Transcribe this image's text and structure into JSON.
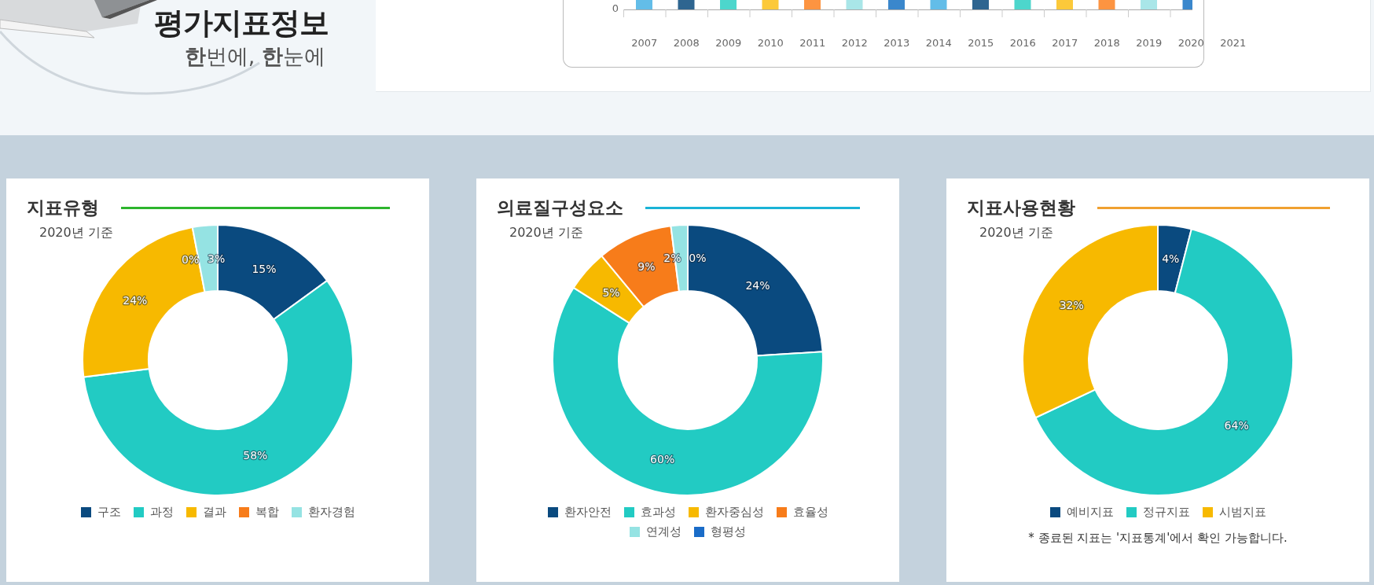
{
  "logo": {
    "title": "평가지표정보",
    "slogan": "**한**번에, **한**눈에"
  },
  "trend_chart": {
    "zero_label": "0",
    "years": [
      "2007",
      "2008",
      "2009",
      "2010",
      "2011",
      "2012",
      "2013",
      "2014",
      "2015",
      "2016",
      "2017",
      "2018",
      "2019",
      "2020",
      "2021"
    ]
  },
  "cards": [
    {
      "title": "지표유형",
      "color": "#2db52d",
      "subtitle": "2020년 기준",
      "chart_data": {
        "type": "donut",
        "categories": [
          "구조",
          "과정",
          "결과",
          "복합",
          "환자경험"
        ],
        "values": [
          15,
          58,
          24,
          0,
          3
        ],
        "value_labels": [
          "15%",
          "58%",
          "24%",
          "0%",
          "3%"
        ]
      },
      "legend": [
        {
          "color": "#0a4a7f"
        },
        {
          "color": "#22cbc3"
        },
        {
          "color": "#f7b900"
        },
        {
          "color": "#f77c1a"
        },
        {
          "color": "#95e3e3"
        }
      ]
    },
    {
      "title": "의료질구성요소",
      "color": "#1ab3d6",
      "subtitle": "2020년 기준",
      "chart_data": {
        "type": "donut",
        "categories": [
          "환자안전",
          "효과성",
          "환자중심성",
          "효율성",
          "연계성",
          "형평성"
        ],
        "values": [
          24,
          60,
          5,
          9,
          2,
          0
        ],
        "value_labels": [
          "24%",
          "60%",
          "5%",
          "9%",
          "2%",
          "0%"
        ]
      },
      "legend": [
        {
          "color": "#0a4a7f"
        },
        {
          "color": "#22cbc3"
        },
        {
          "color": "#f7b900"
        },
        {
          "color": "#f77c1a"
        },
        {
          "color": "#95e3e3"
        },
        {
          "color": "#1a6cc8"
        }
      ]
    },
    {
      "title": "지표사용현황",
      "color": "#f0a030",
      "subtitle": "2020년 기준",
      "chart_data": {
        "type": "donut",
        "categories": [
          "예비지표",
          "정규지표",
          "시범지표"
        ],
        "values": [
          4,
          64,
          32
        ],
        "value_labels": [
          "4%",
          "64%",
          "32%"
        ]
      },
      "legend": [
        {
          "color": "#0a4a7f"
        },
        {
          "color": "#22cbc3"
        },
        {
          "color": "#f7b900"
        }
      ],
      "footnote": "* 종료된 지표는 '지표통계'에서 확인 가능합니다."
    }
  ]
}
